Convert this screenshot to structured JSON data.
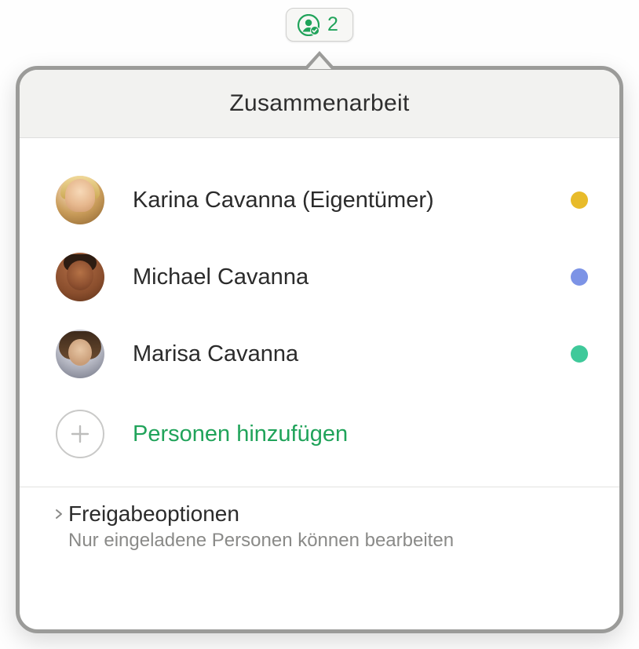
{
  "badge": {
    "count": "2",
    "icon_name": "person-circle-checkmark"
  },
  "popover": {
    "title": "Zusammenarbeit"
  },
  "participants": [
    {
      "name": "Karina Cavanna (Eigentümer)",
      "status_color": "#e8bb2a",
      "avatar_class": "a1"
    },
    {
      "name": "Michael Cavanna",
      "status_color": "#7c93e6",
      "avatar_class": "a2"
    },
    {
      "name": "Marisa Cavanna",
      "status_color": "#3fc99a",
      "avatar_class": "a3"
    }
  ],
  "add_people": {
    "label": "Personen hinzufügen"
  },
  "share_options": {
    "title": "Freigabeoptionen",
    "subtitle": "Nur eingeladene Personen können bearbeiten"
  },
  "colors": {
    "accent_green": "#20a35a"
  }
}
